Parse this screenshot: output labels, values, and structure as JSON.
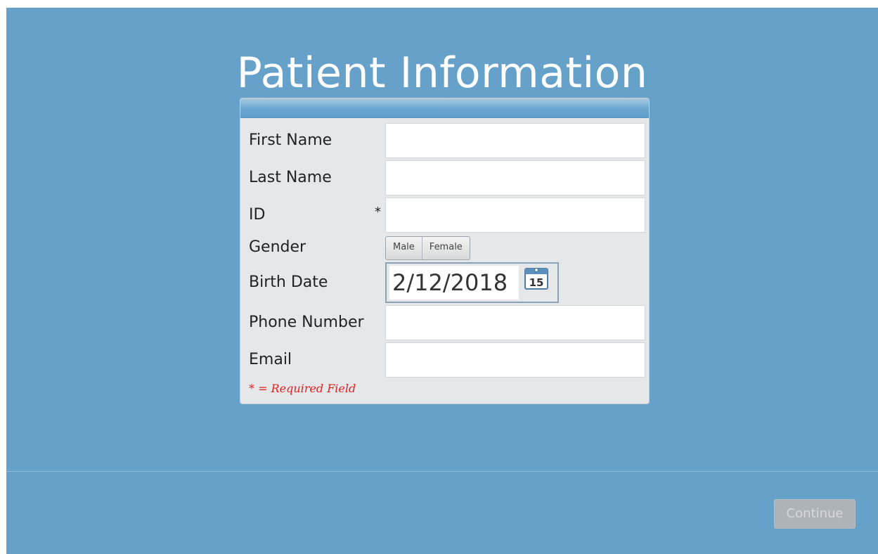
{
  "page": {
    "title": "Patient Information"
  },
  "form": {
    "fields": [
      {
        "label": "First Name",
        "value": "",
        "required": false
      },
      {
        "label": "Last Name",
        "value": "",
        "required": false
      },
      {
        "label": "ID",
        "value": "",
        "required": true,
        "required_marker": "*"
      },
      {
        "label": "Gender",
        "options": [
          "Male",
          "Female"
        ],
        "selected": null
      },
      {
        "label": "Birth Date",
        "value": "2/12/2018",
        "calendar_day": "15"
      },
      {
        "label": "Phone Number",
        "value": "",
        "required": false
      },
      {
        "label": "Email",
        "value": "",
        "required": false
      }
    ],
    "required_note": "* = Required Field"
  },
  "footer": {
    "continue_label": "Continue",
    "continue_enabled": false
  },
  "colors": {
    "background": "#66a1c9",
    "card": "#e6e7e9",
    "required_note": "#e02020",
    "continue_disabled": "#adb3b8"
  },
  "icons": {
    "calendar": "calendar-icon"
  }
}
